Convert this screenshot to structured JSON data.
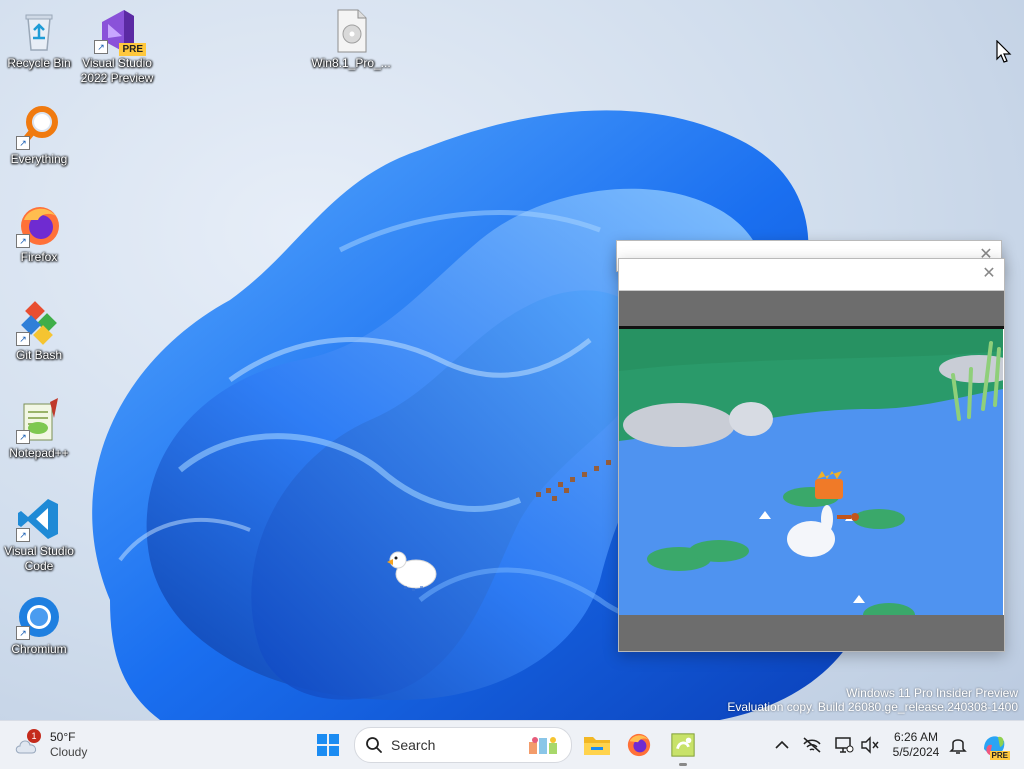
{
  "desktop": {
    "icons": [
      {
        "label": "Recycle Bin"
      },
      {
        "label": "Visual Studio\n2022 Preview",
        "badge": "PRE"
      },
      {
        "label": "Win8.1_Pro_..."
      },
      {
        "label": "Everything"
      },
      {
        "label": "Firefox"
      },
      {
        "label": "Git Bash"
      },
      {
        "label": "Notepad++"
      },
      {
        "label": "Visual Studio\nCode"
      },
      {
        "label": "Chromium"
      }
    ],
    "watermark": {
      "line1": "Windows 11 Pro Insider Preview",
      "line2": "Evaluation copy. Build 26080.ge_release.240308-1400"
    }
  },
  "windows": {
    "back_close_glyph": "✕",
    "front_close_glyph": "✕"
  },
  "taskbar": {
    "weather": {
      "temp": "50°F",
      "condition": "Cloudy",
      "badge": "1"
    },
    "search_placeholder": "Search",
    "clock": {
      "time": "6:26 AM",
      "date": "5/5/2024"
    },
    "tray_chevron": "^",
    "copilot_badge": "PRE"
  },
  "colors": {
    "accent": "#0067c0",
    "pond_water": "#4f93f0",
    "grass": "#2a9a6a",
    "game_frame": "#6d6d6d"
  },
  "icons": [
    "recycle-bin-icon",
    "visual-studio-icon",
    "disc-file-icon",
    "everything-icon",
    "firefox-icon",
    "git-bash-icon",
    "notepad-plus-icon",
    "vscode-icon",
    "chromium-icon",
    "windows-start-icon",
    "search-icon",
    "file-explorer-icon",
    "bell-icon",
    "copilot-icon"
  ]
}
